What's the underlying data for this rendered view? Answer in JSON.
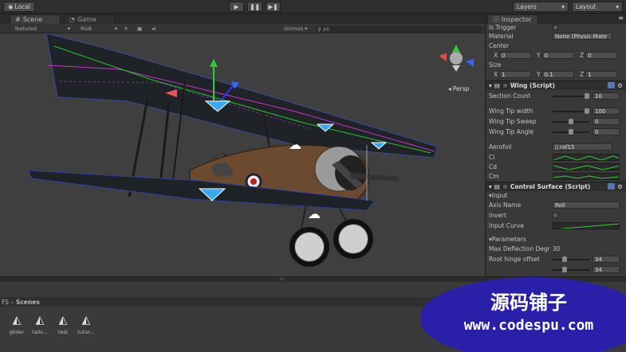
{
  "toolbar": {
    "local_label": "Local",
    "play_icon": "play-icon",
    "pause_icon": "pause-icon",
    "step_icon": "step-icon",
    "layers_label": "Layers",
    "layout_label": "Layout"
  },
  "tabs": {
    "scene_label": "Scene",
    "game_label": "Game",
    "inspector_label": "Inspector"
  },
  "scene_controls": {
    "shading_mode": "Textured",
    "render_mode": "RGB",
    "gizmos_label": "Gizmos",
    "search_placeholder": "All"
  },
  "viewport": {
    "persp_label": "Persp"
  },
  "inspector": {
    "is_trigger_label": "Is Trigger",
    "material_label": "Material",
    "material_value": "None (Physic Mate",
    "center_label": "Center",
    "center": {
      "x": "0",
      "y": "0",
      "z": "0"
    },
    "size_label": "Size",
    "size": {
      "x": "1",
      "y": "0.1",
      "z": "1"
    },
    "wing_script": {
      "title": "Wing (Script)",
      "section_count_label": "Section Count",
      "section_count_value": "10",
      "wing_tip_width_label": "Wing Tip width",
      "wing_tip_width_value": "100",
      "wing_tip_sweep_label": "Wing Tip Sweep",
      "wing_tip_sweep_value": "0",
      "wing_tip_angle_label": "Wing Tip Angle",
      "wing_tip_angle_value": "0",
      "aerofoil_label": "Aerofoil",
      "aerofoil_value": "raf15",
      "cl_label": "Cl",
      "cd_label": "Cd",
      "cm_label": "Cm"
    },
    "control_surface": {
      "title": "Control Surface (Script)",
      "input_section": "Input",
      "axis_name_label": "Axis Name",
      "axis_name_value": "Roll",
      "invert_label": "Invert",
      "input_curve_label": "Input Curve",
      "parameters_section": "Parameters",
      "max_deflection_label": "Max Deflection Degr",
      "max_deflection_value": "30",
      "root_hinge_label": "Root hinge offset",
      "root_hinge_value": "34",
      "tip_hinge_value": "34"
    }
  },
  "project": {
    "breadcrumb_prefix": "FS",
    "breadcrumb_folder": "Scenes",
    "scenes": [
      {
        "label": "glider"
      },
      {
        "label": "tailv..."
      },
      {
        "label": "test"
      },
      {
        "label": "tutor..."
      }
    ]
  },
  "watermark": {
    "title": "源码铺子",
    "url": "www.codespu.com",
    "color": "#2a1fa8"
  }
}
